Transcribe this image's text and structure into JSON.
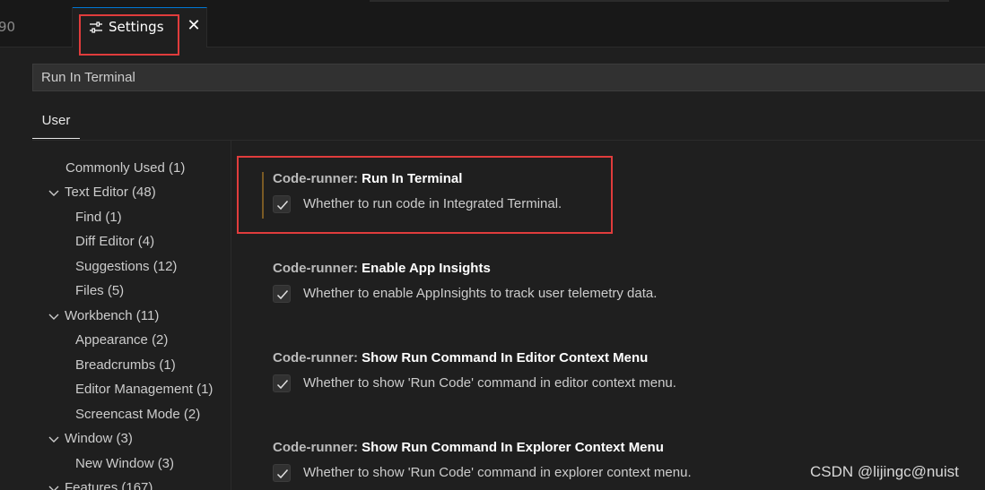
{
  "tabs": {
    "prev_tab_fragment": "90",
    "active_tab_label": "Settings"
  },
  "search": {
    "value": "Run In Terminal"
  },
  "scope": {
    "user_label": "User"
  },
  "toc": [
    {
      "label": "Commonly Used (1)",
      "indent": 0,
      "expandable": false
    },
    {
      "label": "Text Editor (48)",
      "indent": 0,
      "expandable": true
    },
    {
      "label": "Find (1)",
      "indent": 1,
      "expandable": false
    },
    {
      "label": "Diff Editor (4)",
      "indent": 1,
      "expandable": false
    },
    {
      "label": "Suggestions (12)",
      "indent": 1,
      "expandable": false
    },
    {
      "label": "Files (5)",
      "indent": 1,
      "expandable": false
    },
    {
      "label": "Workbench (11)",
      "indent": 0,
      "expandable": true
    },
    {
      "label": "Appearance (2)",
      "indent": 1,
      "expandable": false
    },
    {
      "label": "Breadcrumbs (1)",
      "indent": 1,
      "expandable": false
    },
    {
      "label": "Editor Management (1)",
      "indent": 1,
      "expandable": false
    },
    {
      "label": "Screencast Mode (2)",
      "indent": 1,
      "expandable": false
    },
    {
      "label": "Window (3)",
      "indent": 0,
      "expandable": true
    },
    {
      "label": "New Window (3)",
      "indent": 1,
      "expandable": false
    },
    {
      "label": "Features (167)",
      "indent": 0,
      "expandable": true
    }
  ],
  "settings": [
    {
      "category": "Code-runner: ",
      "name": "Run In Terminal",
      "description": "Whether to run code in Integrated Terminal.",
      "checked": true
    },
    {
      "category": "Code-runner: ",
      "name": "Enable App Insights",
      "description": "Whether to enable AppInsights to track user telemetry data.",
      "checked": true
    },
    {
      "category": "Code-runner: ",
      "name": "Show Run Command In Editor Context Menu",
      "description": "Whether to show 'Run Code' command in editor context menu.",
      "checked": true
    },
    {
      "category": "Code-runner: ",
      "name": "Show Run Command In Explorer Context Menu",
      "description": "Whether to show 'Run Code' command in explorer context menu.",
      "checked": true
    }
  ],
  "watermark": "CSDN @lijingc@nuist",
  "colors": {
    "highlight_red": "#e03c3c",
    "modified_bar": "#7a5a24",
    "focus_blue": "#0078d4"
  }
}
